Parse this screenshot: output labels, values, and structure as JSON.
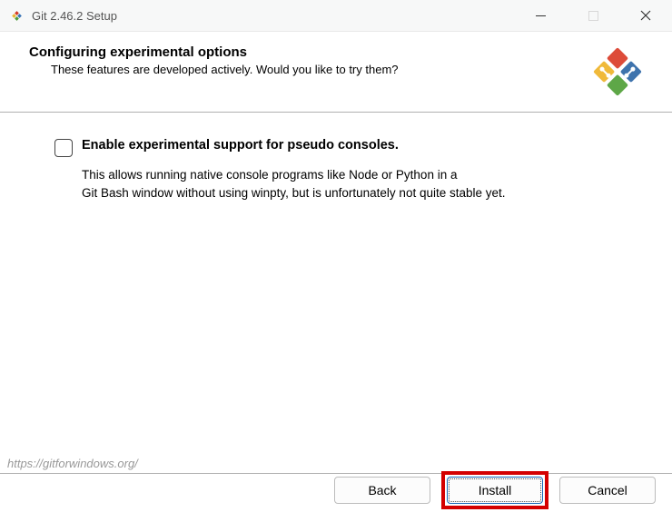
{
  "titlebar": {
    "title": "Git 2.46.2 Setup"
  },
  "header": {
    "title": "Configuring experimental options",
    "subtitle": "These features are developed actively. Would you like to try them?"
  },
  "option": {
    "label": "Enable experimental support for pseudo consoles.",
    "desc_line1": "This allows running native console programs like Node or Python in a",
    "desc_line2": "Git Bash window without using winpty, but is unfortunately not quite stable yet."
  },
  "footer": {
    "link": "https://gitforwindows.org/"
  },
  "buttons": {
    "back": "Back",
    "install": "Install",
    "cancel": "Cancel"
  }
}
